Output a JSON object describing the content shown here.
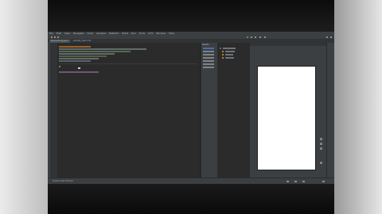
{
  "menu": [
    "File",
    "Edit",
    "View",
    "Navigate",
    "Code",
    "Analyze",
    "Refactor",
    "Build",
    "Run",
    "Tools",
    "VCS",
    "Window",
    "Help"
  ],
  "tabs": [
    "MainActivity.java",
    "activity_main.xml"
  ],
  "palette": {
    "header": "Palette"
  },
  "status": {
    "text": "Gradle build finished"
  },
  "colors": {
    "ide_bg": "#2b2b2b",
    "panel": "#3c3f41",
    "canvas": "#ffffff",
    "selection": "#4b6eaf"
  }
}
